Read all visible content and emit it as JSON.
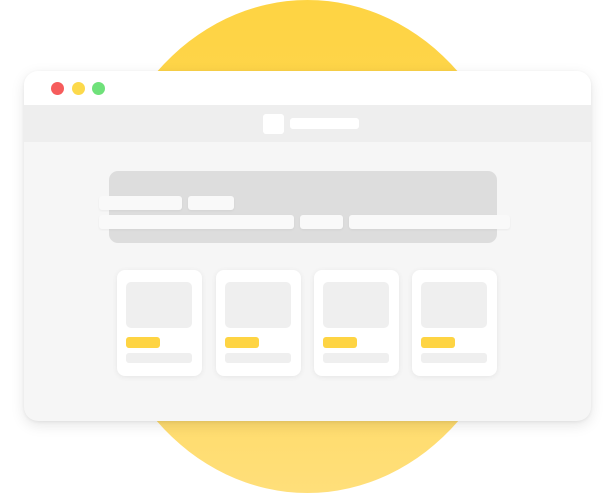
{
  "colors": {
    "accent": "#fed443",
    "traffic_red": "#f65c5c",
    "traffic_yellow": "#fcd94b",
    "traffic_green": "#6fe17a",
    "tag": "#fed443"
  },
  "window": {
    "controls": [
      {
        "name": "close",
        "icon": "red-dot-icon"
      },
      {
        "name": "minimize",
        "icon": "yellow-dot-icon"
      },
      {
        "name": "maximize",
        "icon": "green-dot-icon"
      }
    ]
  },
  "address_bar": {
    "url": "",
    "favicon_icon": "favicon-icon"
  },
  "hero": {
    "row1": [
      "",
      ""
    ],
    "row2": [
      "",
      "",
      ""
    ]
  },
  "cards": [
    {
      "label": "",
      "caption": ""
    },
    {
      "label": "",
      "caption": ""
    },
    {
      "label": "",
      "caption": ""
    },
    {
      "label": "",
      "caption": ""
    }
  ]
}
